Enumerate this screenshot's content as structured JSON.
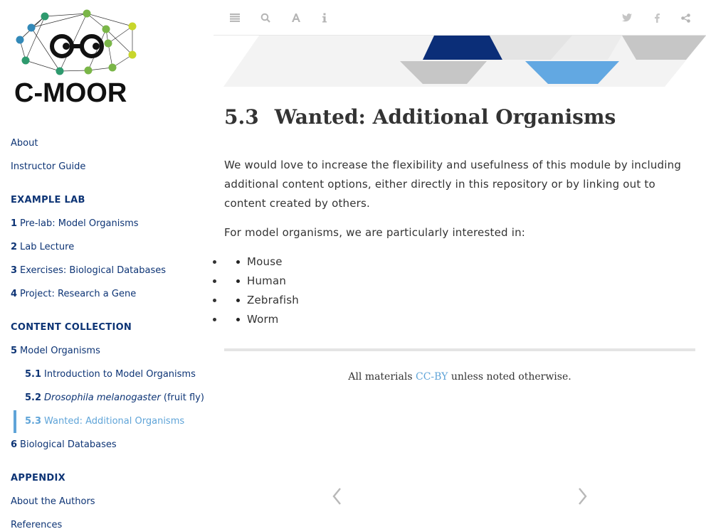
{
  "logo": {
    "text": "C-MOOR",
    "node_colors": [
      "#2e9a6e",
      "#7ab648",
      "#c8d62b",
      "#3389b8"
    ]
  },
  "toolbar": {
    "left": [
      {
        "icon": "menu-icon"
      },
      {
        "icon": "search-icon"
      },
      {
        "icon": "font-icon"
      },
      {
        "icon": "info-icon"
      }
    ],
    "right": [
      {
        "icon": "twitter-icon"
      },
      {
        "icon": "facebook-icon"
      },
      {
        "icon": "share-icon"
      }
    ]
  },
  "sidebar": {
    "about": "About",
    "instructor_guide": "Instructor Guide",
    "example_lab_header": "EXAMPLE LAB",
    "ch1": {
      "num": "1",
      "label": "Pre-lab: Model Organisms"
    },
    "ch2": {
      "num": "2",
      "label": "Lab Lecture"
    },
    "ch3": {
      "num": "3",
      "label": "Exercises: Biological Databases"
    },
    "ch4": {
      "num": "4",
      "label": "Project: Research a Gene"
    },
    "content_collection_header": "CONTENT COLLECTION",
    "ch5": {
      "num": "5",
      "label": "Model Organisms"
    },
    "s51": {
      "num": "5.1",
      "label": "Introduction to Model Organisms"
    },
    "s52": {
      "num": "5.2",
      "latin": "Drosophila melanogaster",
      "label": " (fruit fly)"
    },
    "s53": {
      "num": "5.3",
      "label": "Wanted: Additional Organisms"
    },
    "ch6": {
      "num": "6",
      "label": "Biological Databases"
    },
    "appendix_header": "APPENDIX",
    "about_authors": "About the Authors",
    "references": "References"
  },
  "main": {
    "title_num": "5.3",
    "title_text": "Wanted: Additional Organisms",
    "para1": "We would love to increase the flexibility and usefulness of this module by including additional content options, either directly in this repository or by linking out to content created by others.",
    "para2": "For model organisms, we are particularly interested in:",
    "organisms": [
      "Mouse",
      "Human",
      "Zebrafish",
      "Worm"
    ],
    "footer_prefix": "All materials ",
    "footer_link": "CC-BY",
    "footer_suffix": " unless noted otherwise."
  },
  "colors": {
    "link": "#0d3475",
    "accent": "#5fa4d8",
    "banner_navy": "#0b2e78",
    "banner_blue": "#62a8e2"
  }
}
